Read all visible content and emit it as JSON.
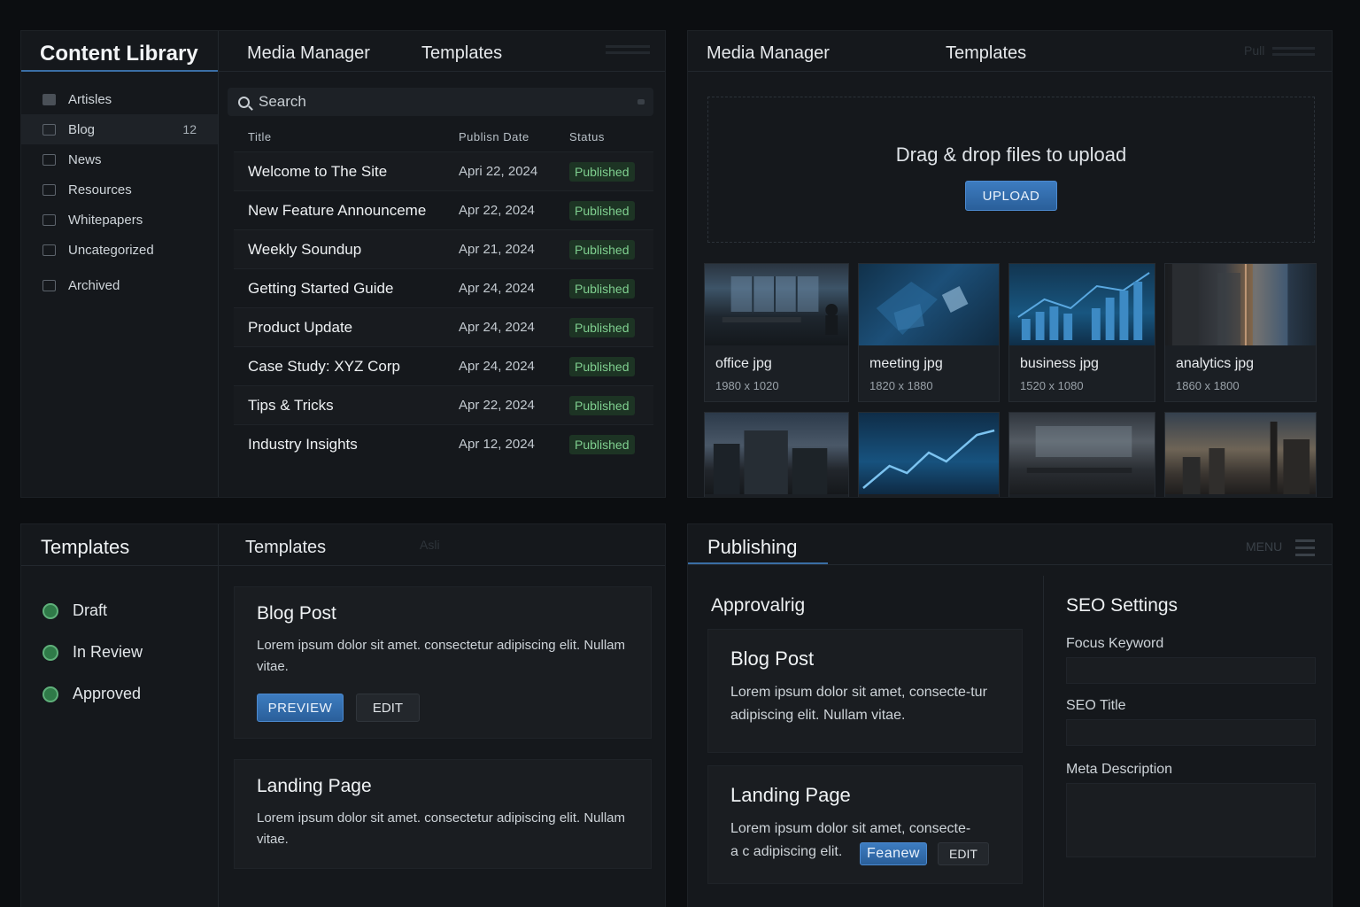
{
  "library": {
    "title": "Content Library",
    "tabs": [
      "Media Manager",
      "Templates"
    ],
    "categories": [
      {
        "label": "Artisles",
        "count": ""
      },
      {
        "label": "Blog",
        "count": "12"
      },
      {
        "label": "News",
        "count": ""
      },
      {
        "label": "Resources",
        "count": ""
      },
      {
        "label": "Whitepapers",
        "count": ""
      },
      {
        "label": "Uncategorized",
        "count": ""
      },
      {
        "label": "Archived",
        "count": ""
      }
    ],
    "search_placeholder": "Search",
    "columns": [
      "Title",
      "Publisn Date",
      "Status"
    ],
    "rows": [
      {
        "title": "Welcome to The Site",
        "date": "Apri 22, 2024",
        "status": "Published"
      },
      {
        "title": "New Feature Announceme",
        "date": "Apr 22, 2024",
        "status": "Published"
      },
      {
        "title": "Weekly Soundup",
        "date": "Apr 21, 2024",
        "status": "Published"
      },
      {
        "title": "Getting Started Guide",
        "date": "Apr 24, 2024",
        "status": "Published"
      },
      {
        "title": "Product Update",
        "date": "Apr 24, 2024",
        "status": "Published"
      },
      {
        "title": "Case Study: XYZ Corp",
        "date": "Apr 24, 2024",
        "status": "Published"
      },
      {
        "title": "Tips & Tricks",
        "date": "Apr 22, 2024",
        "status": "Published"
      },
      {
        "title": "Industry Insights",
        "date": "Apr 12, 2024",
        "status": "Published"
      }
    ]
  },
  "media": {
    "tabs": [
      "Media Manager",
      "Templates"
    ],
    "faint_label": "Pull",
    "dropzone_text": "Drag & drop files to upload",
    "upload_label": "UPLOAD",
    "files": [
      {
        "name": "office jpg",
        "dims": "1980 x 1020",
        "icon": "office-photo"
      },
      {
        "name": "meeting jpg",
        "dims": "1820 x 1880",
        "icon": "meeting-photo"
      },
      {
        "name": "business jpg",
        "dims": "1520 x 1080",
        "icon": "business-chart-photo"
      },
      {
        "name": "analytics jpg",
        "dims": "1860 x 1800",
        "icon": "analytics-city-photo"
      }
    ],
    "second_row": [
      "city-buildings-photo",
      "line-chart-photo",
      "office-room-photo",
      "city-skyline-photo"
    ]
  },
  "templates": {
    "sidebar_title": "Templates",
    "header_title": "Templates",
    "faint_label": "Asli",
    "statuses": [
      "Draft",
      "In Review",
      "Approved"
    ],
    "cards": [
      {
        "title": "Blog Post",
        "body": "Lorem ipsum dolor sit amet. consectetur adipiscing elit. Nullam vitae.",
        "preview": "PREVIEW",
        "edit": "EDIT"
      },
      {
        "title": "Landing Page",
        "body": "Lorem ipsum dolor sit amet. consectetur adipiscing elit. Nullam vitae."
      }
    ]
  },
  "publishing": {
    "title": "Publishing",
    "menu_label": "MENU",
    "approval_title": "Approvalrig",
    "cards": [
      {
        "title": "Blog Post",
        "body": "Lorem ipsum dolor sit amet, consecte-tur adipiscing elit. Nullam vitae."
      },
      {
        "title": "Landing Page",
        "body_line1": "Lorem ipsum dolor sit amet, consecte-",
        "body_line2": "a c adipiscing elit.",
        "preview": "Feanew",
        "edit": "EDIT"
      }
    ],
    "seo": {
      "title": "SEO Settings",
      "focus_keyword": "Focus Keyword",
      "seo_title": "SEO Title",
      "meta_description": "Meta Description"
    }
  },
  "colors": {
    "accent": "#3a6ea5",
    "success": "#7fcf8f",
    "background": "#0c0e11",
    "panel": "#15181c"
  }
}
